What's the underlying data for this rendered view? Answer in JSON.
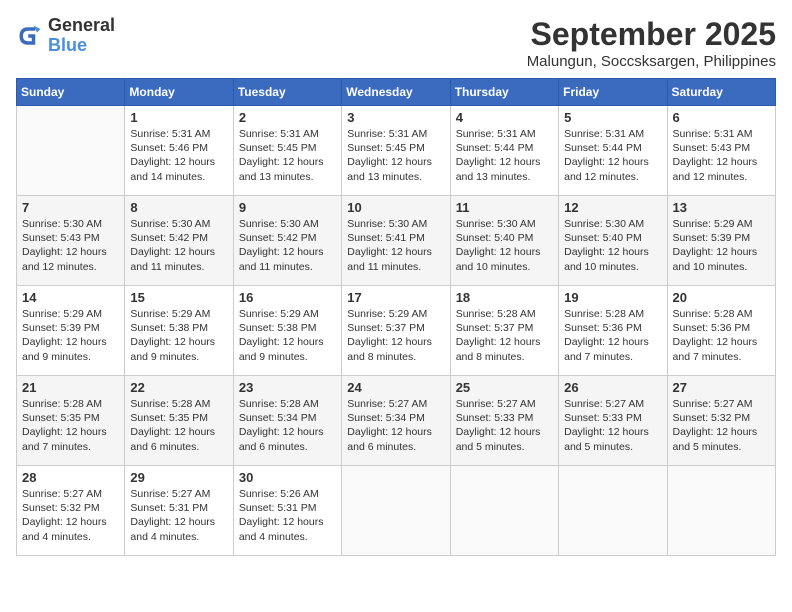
{
  "logo": {
    "line1": "General",
    "line2": "Blue"
  },
  "title": "September 2025",
  "subtitle": "Malungun, Soccsksargen, Philippines",
  "days_of_week": [
    "Sunday",
    "Monday",
    "Tuesday",
    "Wednesday",
    "Thursday",
    "Friday",
    "Saturday"
  ],
  "weeks": [
    [
      {
        "day": "",
        "info": ""
      },
      {
        "day": "1",
        "info": "Sunrise: 5:31 AM\nSunset: 5:46 PM\nDaylight: 12 hours\nand 14 minutes."
      },
      {
        "day": "2",
        "info": "Sunrise: 5:31 AM\nSunset: 5:45 PM\nDaylight: 12 hours\nand 13 minutes."
      },
      {
        "day": "3",
        "info": "Sunrise: 5:31 AM\nSunset: 5:45 PM\nDaylight: 12 hours\nand 13 minutes."
      },
      {
        "day": "4",
        "info": "Sunrise: 5:31 AM\nSunset: 5:44 PM\nDaylight: 12 hours\nand 13 minutes."
      },
      {
        "day": "5",
        "info": "Sunrise: 5:31 AM\nSunset: 5:44 PM\nDaylight: 12 hours\nand 12 minutes."
      },
      {
        "day": "6",
        "info": "Sunrise: 5:31 AM\nSunset: 5:43 PM\nDaylight: 12 hours\nand 12 minutes."
      }
    ],
    [
      {
        "day": "7",
        "info": "Sunrise: 5:30 AM\nSunset: 5:43 PM\nDaylight: 12 hours\nand 12 minutes."
      },
      {
        "day": "8",
        "info": "Sunrise: 5:30 AM\nSunset: 5:42 PM\nDaylight: 12 hours\nand 11 minutes."
      },
      {
        "day": "9",
        "info": "Sunrise: 5:30 AM\nSunset: 5:42 PM\nDaylight: 12 hours\nand 11 minutes."
      },
      {
        "day": "10",
        "info": "Sunrise: 5:30 AM\nSunset: 5:41 PM\nDaylight: 12 hours\nand 11 minutes."
      },
      {
        "day": "11",
        "info": "Sunrise: 5:30 AM\nSunset: 5:40 PM\nDaylight: 12 hours\nand 10 minutes."
      },
      {
        "day": "12",
        "info": "Sunrise: 5:30 AM\nSunset: 5:40 PM\nDaylight: 12 hours\nand 10 minutes."
      },
      {
        "day": "13",
        "info": "Sunrise: 5:29 AM\nSunset: 5:39 PM\nDaylight: 12 hours\nand 10 minutes."
      }
    ],
    [
      {
        "day": "14",
        "info": "Sunrise: 5:29 AM\nSunset: 5:39 PM\nDaylight: 12 hours\nand 9 minutes."
      },
      {
        "day": "15",
        "info": "Sunrise: 5:29 AM\nSunset: 5:38 PM\nDaylight: 12 hours\nand 9 minutes."
      },
      {
        "day": "16",
        "info": "Sunrise: 5:29 AM\nSunset: 5:38 PM\nDaylight: 12 hours\nand 9 minutes."
      },
      {
        "day": "17",
        "info": "Sunrise: 5:29 AM\nSunset: 5:37 PM\nDaylight: 12 hours\nand 8 minutes."
      },
      {
        "day": "18",
        "info": "Sunrise: 5:28 AM\nSunset: 5:37 PM\nDaylight: 12 hours\nand 8 minutes."
      },
      {
        "day": "19",
        "info": "Sunrise: 5:28 AM\nSunset: 5:36 PM\nDaylight: 12 hours\nand 7 minutes."
      },
      {
        "day": "20",
        "info": "Sunrise: 5:28 AM\nSunset: 5:36 PM\nDaylight: 12 hours\nand 7 minutes."
      }
    ],
    [
      {
        "day": "21",
        "info": "Sunrise: 5:28 AM\nSunset: 5:35 PM\nDaylight: 12 hours\nand 7 minutes."
      },
      {
        "day": "22",
        "info": "Sunrise: 5:28 AM\nSunset: 5:35 PM\nDaylight: 12 hours\nand 6 minutes."
      },
      {
        "day": "23",
        "info": "Sunrise: 5:28 AM\nSunset: 5:34 PM\nDaylight: 12 hours\nand 6 minutes."
      },
      {
        "day": "24",
        "info": "Sunrise: 5:27 AM\nSunset: 5:34 PM\nDaylight: 12 hours\nand 6 minutes."
      },
      {
        "day": "25",
        "info": "Sunrise: 5:27 AM\nSunset: 5:33 PM\nDaylight: 12 hours\nand 5 minutes."
      },
      {
        "day": "26",
        "info": "Sunrise: 5:27 AM\nSunset: 5:33 PM\nDaylight: 12 hours\nand 5 minutes."
      },
      {
        "day": "27",
        "info": "Sunrise: 5:27 AM\nSunset: 5:32 PM\nDaylight: 12 hours\nand 5 minutes."
      }
    ],
    [
      {
        "day": "28",
        "info": "Sunrise: 5:27 AM\nSunset: 5:32 PM\nDaylight: 12 hours\nand 4 minutes."
      },
      {
        "day": "29",
        "info": "Sunrise: 5:27 AM\nSunset: 5:31 PM\nDaylight: 12 hours\nand 4 minutes."
      },
      {
        "day": "30",
        "info": "Sunrise: 5:26 AM\nSunset: 5:31 PM\nDaylight: 12 hours\nand 4 minutes."
      },
      {
        "day": "",
        "info": ""
      },
      {
        "day": "",
        "info": ""
      },
      {
        "day": "",
        "info": ""
      },
      {
        "day": "",
        "info": ""
      }
    ]
  ]
}
